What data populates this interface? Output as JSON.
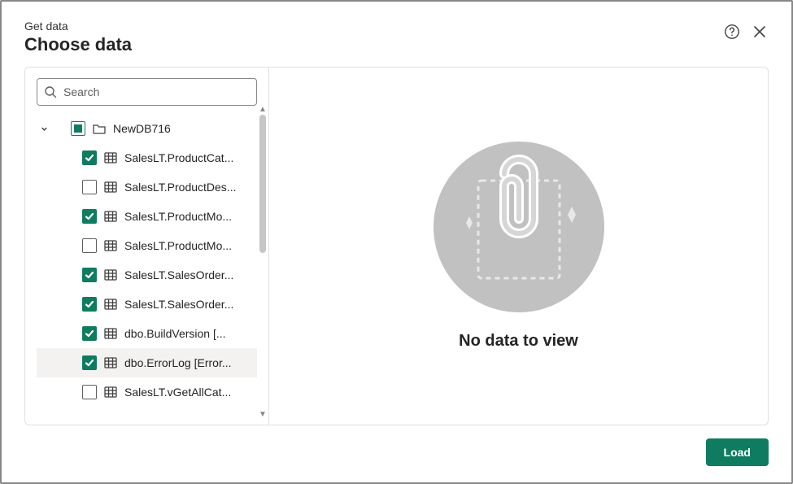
{
  "header": {
    "subtitle": "Get data",
    "title": "Choose data"
  },
  "search": {
    "placeholder": "Search"
  },
  "tree": {
    "root": {
      "label": "NewDB716",
      "state": "indeterminate",
      "expanded": true
    },
    "items": [
      {
        "label": "SalesLT.ProductCat...",
        "checked": true
      },
      {
        "label": "SalesLT.ProductDes...",
        "checked": false
      },
      {
        "label": "SalesLT.ProductMo...",
        "checked": true
      },
      {
        "label": "SalesLT.ProductMo...",
        "checked": false
      },
      {
        "label": "SalesLT.SalesOrder...",
        "checked": true
      },
      {
        "label": "SalesLT.SalesOrder...",
        "checked": true
      },
      {
        "label": "dbo.BuildVersion [...",
        "checked": true
      },
      {
        "label": "dbo.ErrorLog [Error...",
        "checked": true,
        "hover": true
      },
      {
        "label": "SalesLT.vGetAllCat...",
        "checked": false
      }
    ]
  },
  "preview": {
    "empty_text": "No data to view"
  },
  "footer": {
    "load_label": "Load"
  }
}
